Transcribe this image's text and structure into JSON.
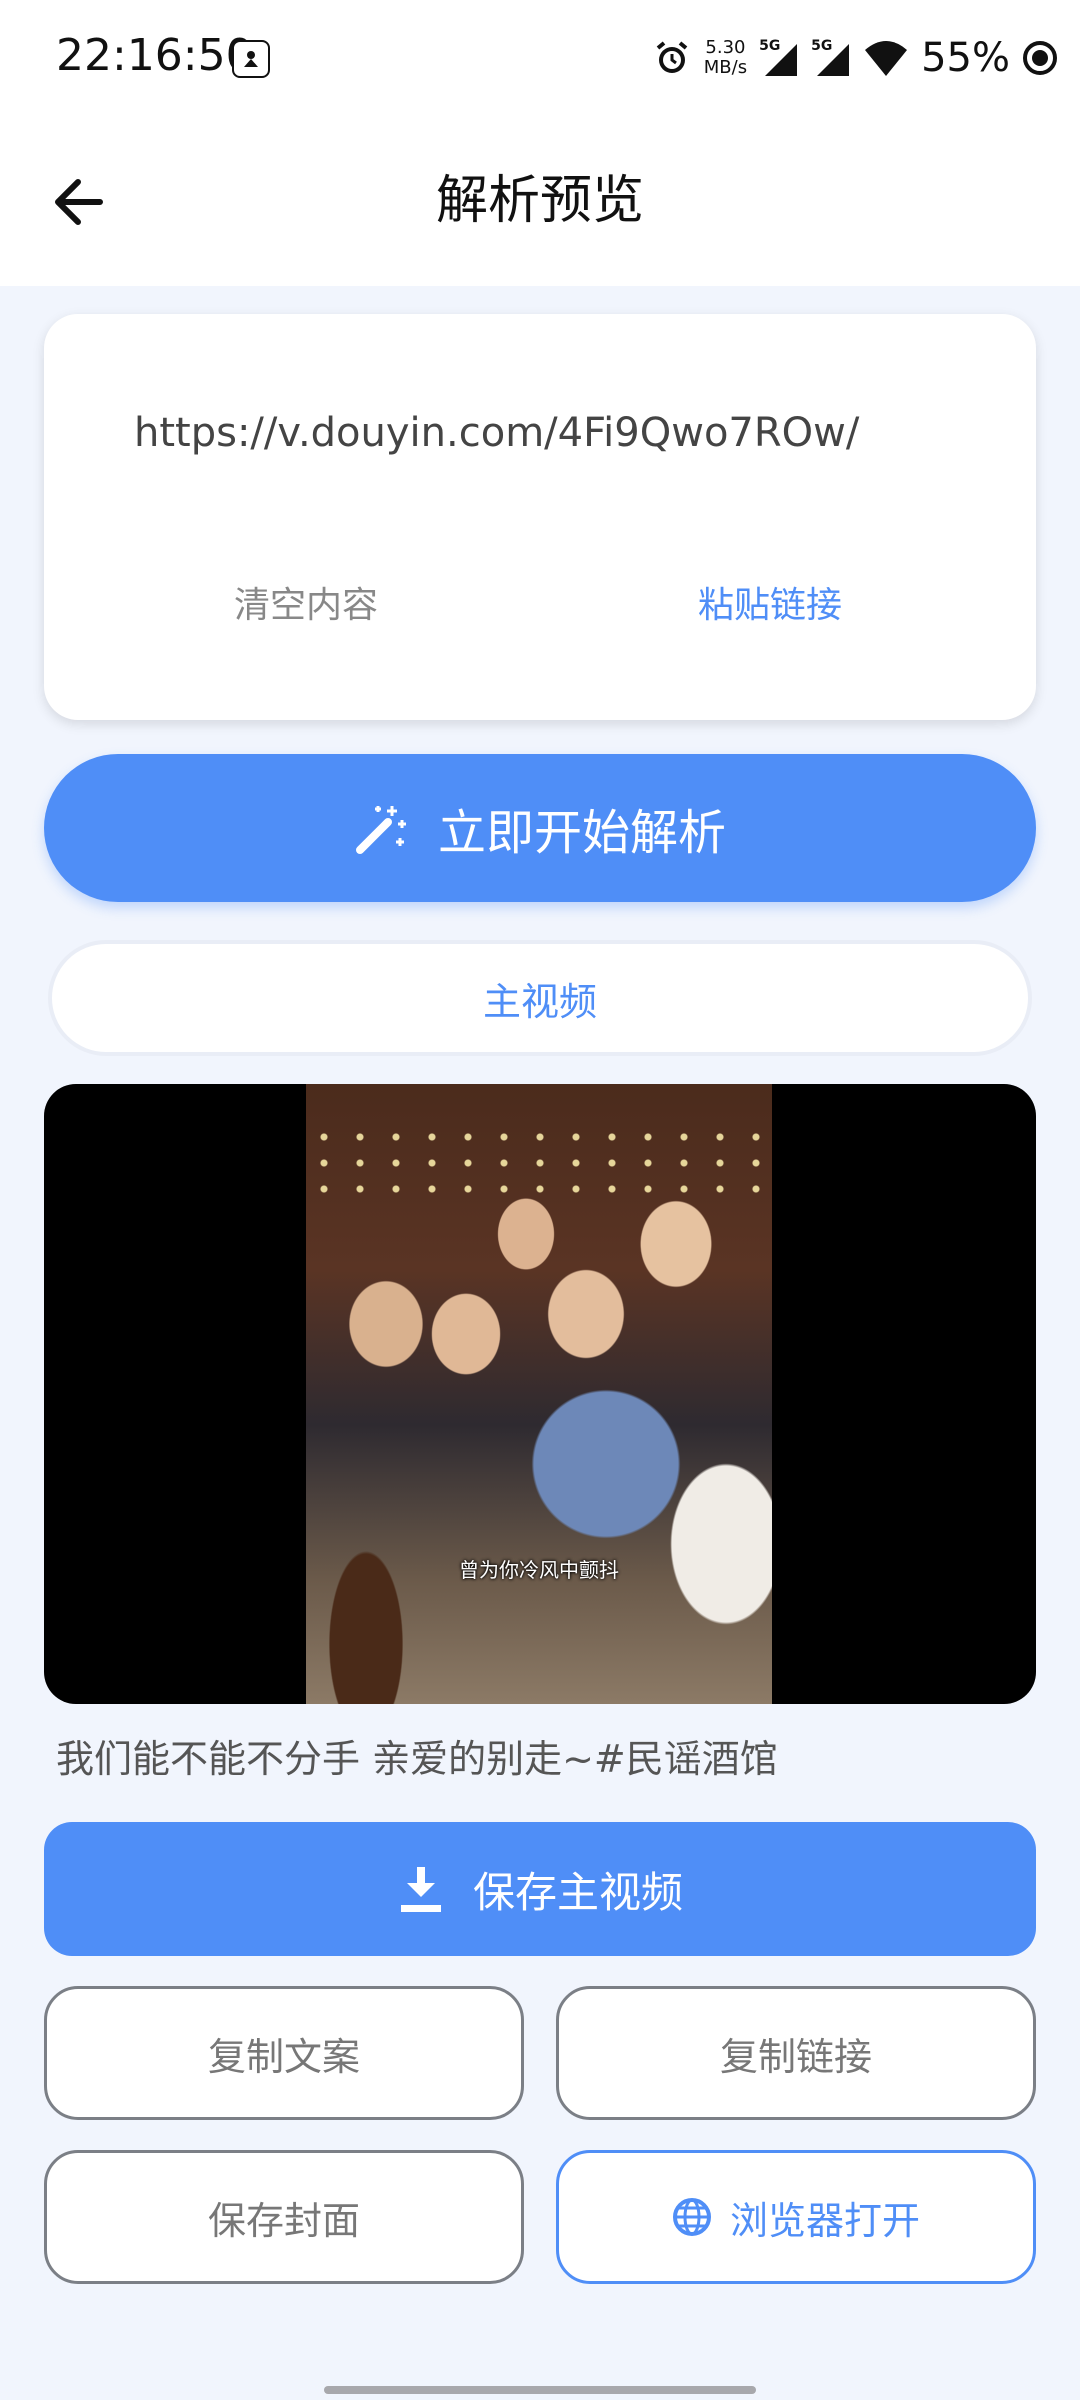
{
  "status_bar": {
    "time": "22:16:50",
    "net_speed_value": "5.30",
    "net_speed_unit": "MB/s",
    "sim1": "5G",
    "sim2": "5G",
    "battery": "55%"
  },
  "header": {
    "title": "解析预览"
  },
  "input_card": {
    "url": "https://v.douyin.com/4Fi9Qwo7ROw/",
    "clear_label": "清空内容",
    "paste_label": "粘贴链接"
  },
  "parse_button": {
    "label": "立即开始解析",
    "icon": "magic-wand-icon"
  },
  "tabs": {
    "main_video": "主视频"
  },
  "video": {
    "subtitle": "曾为你冷风中颤抖"
  },
  "caption": "我们能不能不分手 亲爱的别走~#民谣酒馆",
  "actions": {
    "save_main_video": "保存主视频",
    "copy_text": "复制文案",
    "copy_link": "复制链接",
    "save_cover": "保存封面",
    "open_browser": "浏览器打开"
  },
  "colors": {
    "accent": "#4f8ef7",
    "background": "#f1f5fd"
  }
}
